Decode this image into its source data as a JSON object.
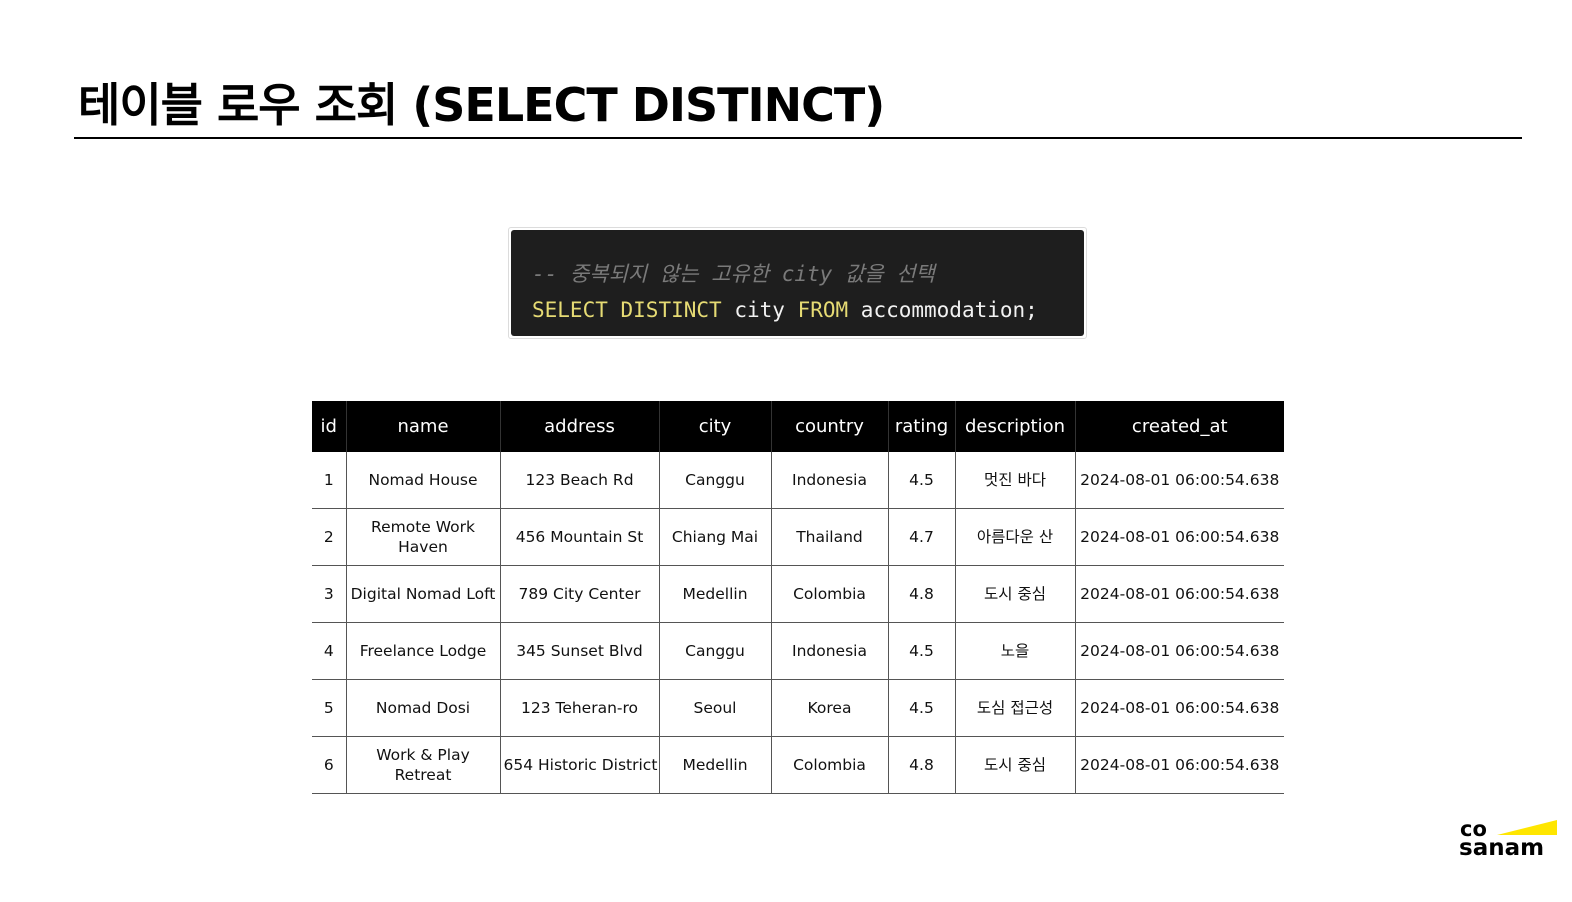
{
  "slide": {
    "title": "테이블 로우 조회 (SELECT DISTINCT)"
  },
  "code": {
    "comment": "-- 중복되지 않는 고유한 city 값을 선택",
    "kw_select": "SELECT",
    "kw_distinct": "DISTINCT",
    "column": "city",
    "kw_from": "FROM",
    "table": "accommodation;"
  },
  "table": {
    "headers": [
      "id",
      "name",
      "address",
      "city",
      "country",
      "rating",
      "description",
      "created_at"
    ],
    "rows": [
      [
        "1",
        "Nomad House",
        "123 Beach Rd",
        "Canggu",
        "Indonesia",
        "4.5",
        "멋진 바다",
        "2024-08-01 06:00:54.638"
      ],
      [
        "2",
        "Remote Work Haven",
        "456 Mountain St",
        "Chiang Mai",
        "Thailand",
        "4.7",
        "아름다운 산",
        "2024-08-01 06:00:54.638"
      ],
      [
        "3",
        "Digital Nomad Loft",
        "789 City Center",
        "Medellin",
        "Colombia",
        "4.8",
        "도시 중심",
        "2024-08-01 06:00:54.638"
      ],
      [
        "4",
        "Freelance Lodge",
        "345 Sunset Blvd",
        "Canggu",
        "Indonesia",
        "4.5",
        "노을",
        "2024-08-01 06:00:54.638"
      ],
      [
        "5",
        "Nomad Dosi",
        "123 Teheran-ro",
        "Seoul",
        "Korea",
        "4.5",
        "도심 접근성",
        "2024-08-01 06:00:54.638"
      ],
      [
        "6",
        "Work & Play Retreat",
        "654 Historic District",
        "Medellin",
        "Colombia",
        "4.8",
        "도시 중심",
        "2024-08-01 06:00:54.638"
      ]
    ]
  },
  "logo": {
    "line1": "co",
    "line2": "sanam",
    "accent_color": "#ffe600"
  }
}
